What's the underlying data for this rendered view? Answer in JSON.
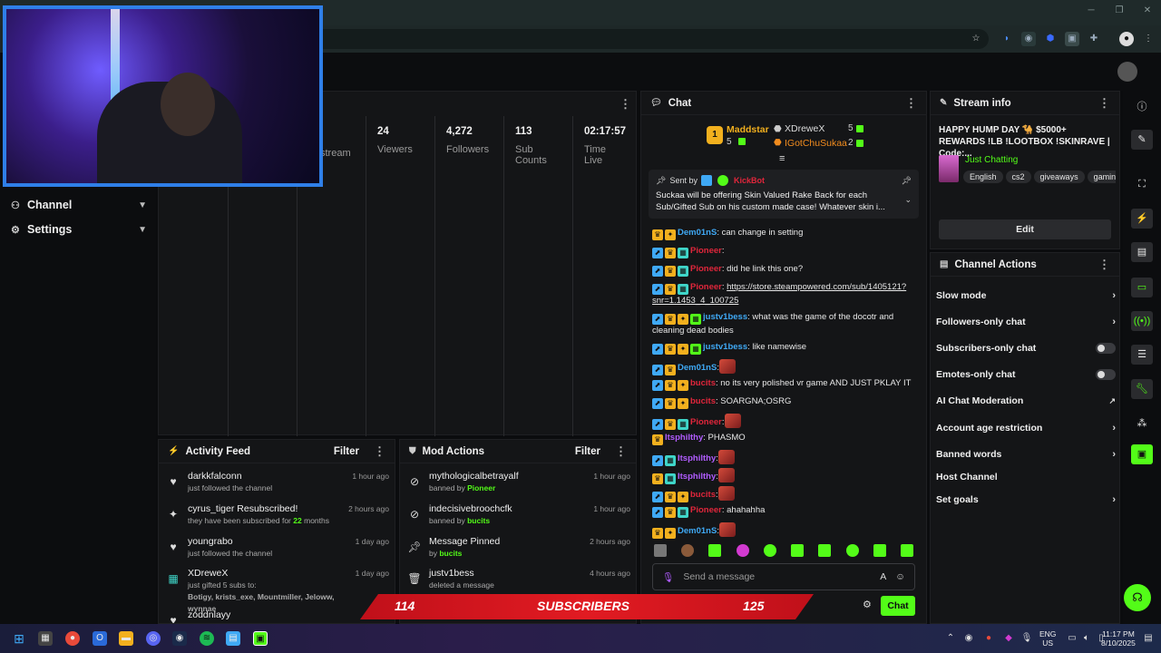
{
  "sidebar": {
    "items": [
      {
        "label": "Channel",
        "icon": "people-icon"
      },
      {
        "label": "Settings",
        "icon": "gear-icon"
      }
    ]
  },
  "stats": {
    "partial_label": "stream",
    "items": [
      {
        "value": "24",
        "label": "Viewers"
      },
      {
        "value": "4,272",
        "label": "Followers"
      },
      {
        "value": "113",
        "label": "Sub Counts"
      },
      {
        "value": "02:17:57",
        "label": "Time Live"
      }
    ]
  },
  "activity_feed": {
    "title": "Activity Feed",
    "filter_label": "Filter",
    "items": [
      {
        "name": "darkkfalconn",
        "sub": "just followed the channel",
        "time": "1 hour ago",
        "icon": "heart-icon"
      },
      {
        "name": "cyrus_tiger Resubscribed!",
        "sub_pre": "they have been subscribed for",
        "sub_num": "22",
        "sub_post": "months",
        "time": "2 hours ago",
        "icon": "sparkle-icon"
      },
      {
        "name": "youngrabo",
        "sub": "just followed the channel",
        "time": "1 day ago",
        "icon": "heart-icon"
      },
      {
        "name": "XDreweX",
        "sub": "just gifted 5 subs to:",
        "gifted_to": "Botigy, krists_exe, Mountmiller, Jeloww, wynnae",
        "time": "1 day ago",
        "icon": "gift-icon"
      },
      {
        "name": "zoddnlayy",
        "time": "1 d",
        "icon": "heart-icon"
      }
    ]
  },
  "mod_actions": {
    "title": "Mod Actions",
    "filter_label": "Filter",
    "items": [
      {
        "name": "mythologicalbetrayalf",
        "sub_pre": "banned by",
        "by": "Pioneer",
        "time": "1 hour ago",
        "icon": "ban-icon"
      },
      {
        "name": "indecisivebroochcfk",
        "sub_pre": "banned by",
        "by": "bucits",
        "time": "1 hour ago",
        "icon": "ban-icon"
      },
      {
        "name": "Message Pinned",
        "sub_pre": "by",
        "by": "bucits",
        "time": "2 hours ago",
        "icon": "pin-icon"
      },
      {
        "name": "justv1bess",
        "sub": "deleted a message",
        "time": "4 hours ago",
        "icon": "trash-icon"
      }
    ]
  },
  "chat": {
    "title": "Chat",
    "leaderboard": {
      "first": {
        "rank": "1",
        "name": "Maddstar",
        "count": "5"
      },
      "second": {
        "name": "XDreweX",
        "count": "5"
      },
      "third": {
        "name": "IGotChuSukaa",
        "count": "2"
      }
    },
    "pinned": {
      "sent_by_label": "Sent by",
      "sender": "KickBot",
      "text": "Suckaa will be offering Skin Valued Rake Back for each Sub/Gifted Sub on his custom made case! Whatever skin i..."
    },
    "messages": [
      {
        "user": "Dem01nS",
        "color": "#3fa9f5",
        "text": ": can change in setting"
      },
      {
        "user": "Pioneer",
        "color": "#e0263b",
        "text": ":"
      },
      {
        "user": "Pioneer",
        "color": "#e0263b",
        "text": ": did he link this one?"
      },
      {
        "user": "Pioneer",
        "color": "#e0263b",
        "text": ": ",
        "link": "https://store.steampowered.com/sub/1405121?snr=1.1453_4_100725"
      },
      {
        "user": "justv1bess",
        "color": "#3fa9f5",
        "text": ": what was the game of the docotr and cleaning dead bodies"
      },
      {
        "user": "justv1bess",
        "color": "#3fa9f5",
        "text": ": like namewise"
      },
      {
        "user": "Dem01nS",
        "color": "#3fa9f5",
        "text": ":"
      },
      {
        "user": "bucits",
        "color": "#e0263b",
        "text": ": no its very polished vr game AND JUST PKLAY IT"
      },
      {
        "user": "bucits",
        "color": "#e0263b",
        "text": ": SOARGNA;OSRG"
      },
      {
        "user": "Pioneer",
        "color": "#e0263b",
        "text": ":"
      },
      {
        "user": "Itsphilthy",
        "color": "#b15cff",
        "text": ": PHASMO"
      },
      {
        "user": "Itsphilthy",
        "color": "#b15cff",
        "text": ":"
      },
      {
        "user": "Itsphilthy",
        "color": "#b15cff",
        "text": ":"
      },
      {
        "user": "bucits",
        "color": "#e0263b",
        "text": ":"
      },
      {
        "user": "Pioneer",
        "color": "#e0263b",
        "text": ": ahahahha"
      },
      {
        "user": "Dem01nS",
        "color": "#3fa9f5",
        "text": ":"
      }
    ],
    "input_placeholder": "Send a message",
    "send_label": "Chat"
  },
  "stream_info": {
    "title": "Stream info",
    "stream_title": "HAPPY HUMP DAY 🐪 $5000+ REWARDS !LB !LOOTBOX !SKINRAVE | Code:...",
    "category": "Just Chatting",
    "tags": [
      "English",
      "cs2",
      "giveaways",
      "gaming"
    ],
    "edit_label": "Edit"
  },
  "channel_actions": {
    "title": "Channel Actions",
    "items": [
      {
        "label": "Slow mode",
        "control": "chevron"
      },
      {
        "label": "Followers-only chat",
        "control": "chevron"
      },
      {
        "label": "Subscribers-only chat",
        "control": "toggle"
      },
      {
        "label": "Emotes-only chat",
        "control": "toggle"
      },
      {
        "label": "AI Chat Moderation",
        "control": "external"
      },
      {
        "label": "Account age restriction",
        "control": "chevron"
      },
      {
        "label": "Banned words",
        "control": "chevron"
      },
      {
        "label": "Host Channel",
        "control": "none"
      },
      {
        "label": "Set goals",
        "control": "chevron"
      }
    ]
  },
  "sub_goal": {
    "current": "114",
    "label": "SUBSCRIBERS",
    "target": "125"
  },
  "taskbar": {
    "lang": "ENG",
    "region": "US",
    "time": "11:17 PM",
    "date": "8/10/2025"
  },
  "colors": {
    "accent": "#53fc18",
    "webcam_border": "#2f7fe8",
    "sub_bar": "#e11b22"
  }
}
